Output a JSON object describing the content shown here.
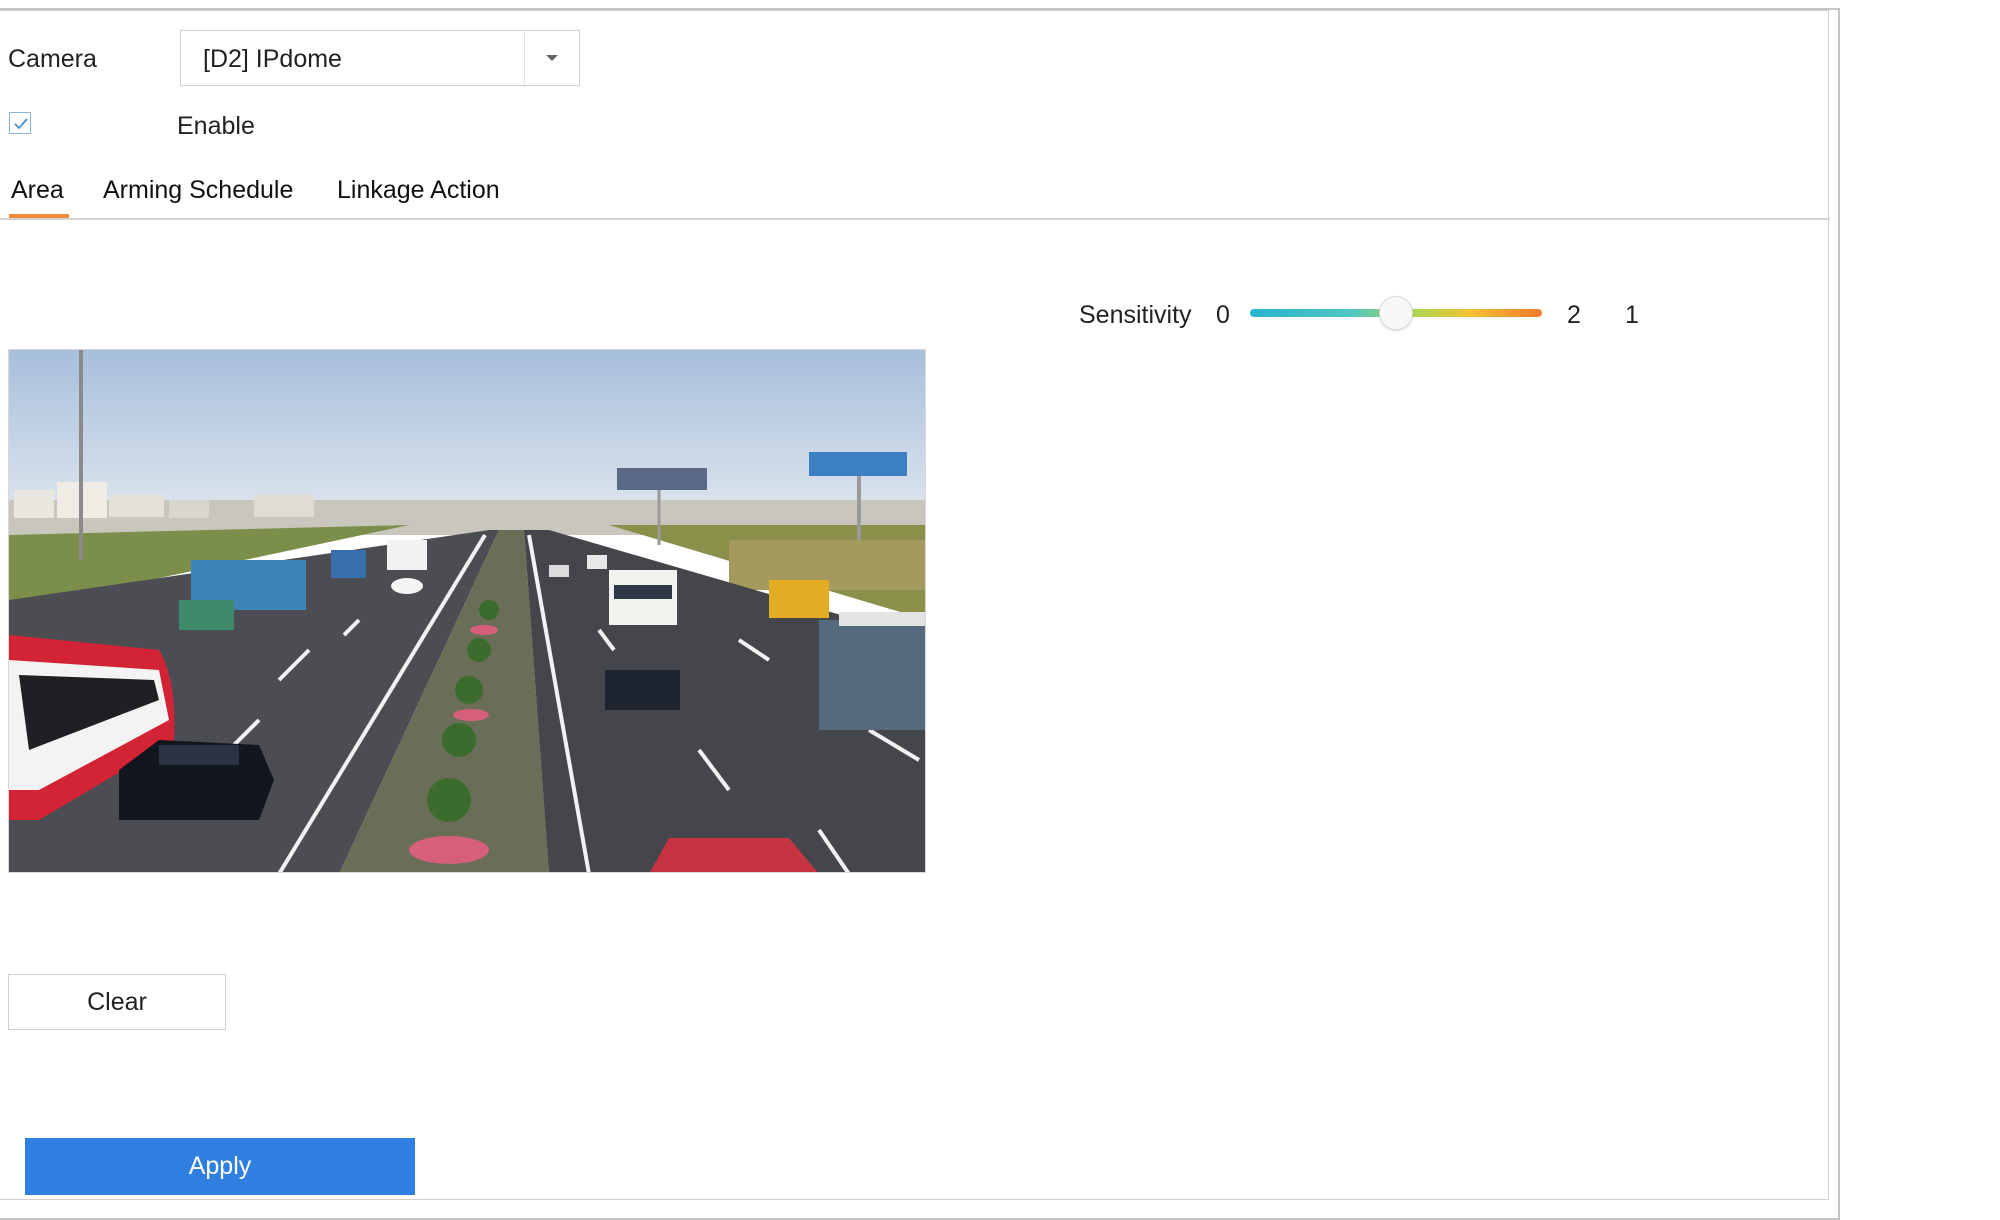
{
  "camera": {
    "label": "Camera",
    "selected": "[D2] IPdome"
  },
  "enable": {
    "label": "Enable",
    "checked": true
  },
  "tabs": [
    {
      "label": "Area",
      "active": true
    },
    {
      "label": "Arming Schedule",
      "active": false
    },
    {
      "label": "Linkage Action",
      "active": false
    }
  ],
  "sensitivity": {
    "label": "Sensitivity",
    "min_label": "0",
    "max_label": "2",
    "value": "1",
    "min": 0,
    "max": 2,
    "current": 1
  },
  "buttons": {
    "clear_label": "Clear",
    "apply_label": "Apply"
  },
  "colors": {
    "accent": "#2f7fe0",
    "tab_underline": "#f08a3c",
    "slider_start": "#27b4d0",
    "slider_end": "#f07c2a"
  }
}
